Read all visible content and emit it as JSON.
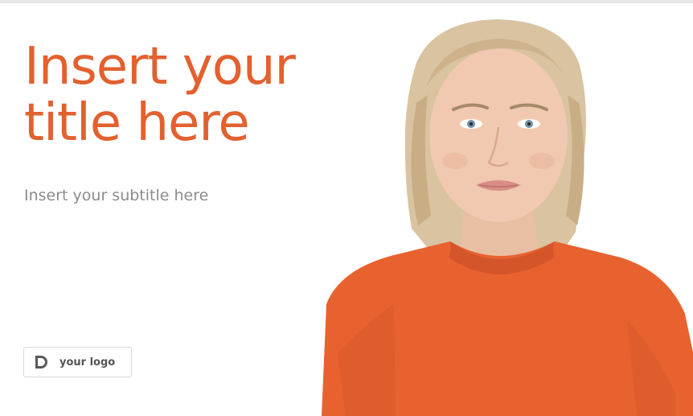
{
  "slide": {
    "title": "Insert your title here",
    "subtitle": "Insert your subtitle here",
    "logo": {
      "text": "your logo",
      "icon": "logo-mark-icon"
    },
    "presenter_image": "presenter-photo"
  },
  "colors": {
    "accent": "#e2612f",
    "subtitle": "#8c8c8c",
    "sweater": "#e8622f",
    "hair": "#d9c3a0"
  }
}
